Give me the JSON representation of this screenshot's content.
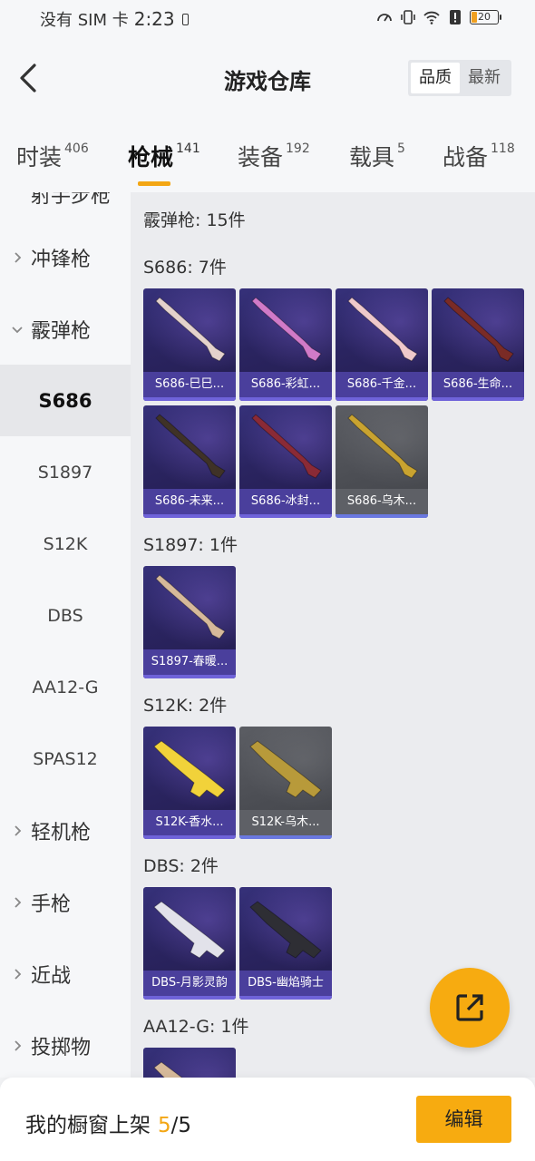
{
  "status_bar": {
    "carrier": "没有 SIM 卡",
    "time": "2:23",
    "battery": "20"
  },
  "header": {
    "title": "游戏仓库",
    "sort_options": [
      "品质",
      "最新"
    ],
    "sort_active": "品质"
  },
  "tabs": [
    {
      "label": "时装",
      "count": "406"
    },
    {
      "label": "枪械",
      "count": "141",
      "active": true
    },
    {
      "label": "装备",
      "count": "192"
    },
    {
      "label": "载具",
      "count": "5"
    },
    {
      "label": "战备",
      "count": "118"
    }
  ],
  "sidebar": {
    "partial_top": "射手步枪",
    "groups": [
      {
        "label": "冲锋枪"
      },
      {
        "label": "霰弹枪",
        "expanded": true,
        "subitems": [
          "S686",
          "S1897",
          "S12K",
          "DBS",
          "AA12-G",
          "SPAS12"
        ],
        "active_sub": "S686"
      },
      {
        "label": "轻机枪"
      },
      {
        "label": "手枪"
      },
      {
        "label": "近战"
      },
      {
        "label": "投掷物"
      }
    ]
  },
  "content": {
    "category_summary": "霰弹枪: 15件",
    "sections": [
      {
        "title": "S686: 7件",
        "items": [
          {
            "name": "S686-巳巳...",
            "style": "purple"
          },
          {
            "name": "S686-彩虹...",
            "style": "purple"
          },
          {
            "name": "S686-千金...",
            "style": "purple"
          },
          {
            "name": "S686-生命...",
            "style": "purple"
          },
          {
            "name": "S686-未来...",
            "style": "purple"
          },
          {
            "name": "S686-冰封...",
            "style": "purple"
          },
          {
            "name": "S686-乌木...",
            "style": "grey"
          }
        ]
      },
      {
        "title": "S1897: 1件",
        "items": [
          {
            "name": "S1897-春暖...",
            "style": "purple"
          }
        ]
      },
      {
        "title": "S12K: 2件",
        "items": [
          {
            "name": "S12K-香水...",
            "style": "purple"
          },
          {
            "name": "S12K-乌木...",
            "style": "grey"
          }
        ]
      },
      {
        "title": "DBS: 2件",
        "items": [
          {
            "name": "DBS-月影灵韵",
            "style": "purple"
          },
          {
            "name": "DBS-幽焰骑士",
            "style": "purple"
          }
        ]
      },
      {
        "title": "AA12-G: 1件",
        "items": [
          {
            "name": "",
            "style": "purple"
          }
        ]
      }
    ]
  },
  "bottom_bar": {
    "shelf_label": "我的橱窗上架",
    "shelf_count": "5",
    "shelf_total": "/5",
    "edit_label": "编辑"
  },
  "colors": {
    "accent": "#f7ab10",
    "card_purple": "#2a2460",
    "card_grey": "#4a4c52"
  }
}
